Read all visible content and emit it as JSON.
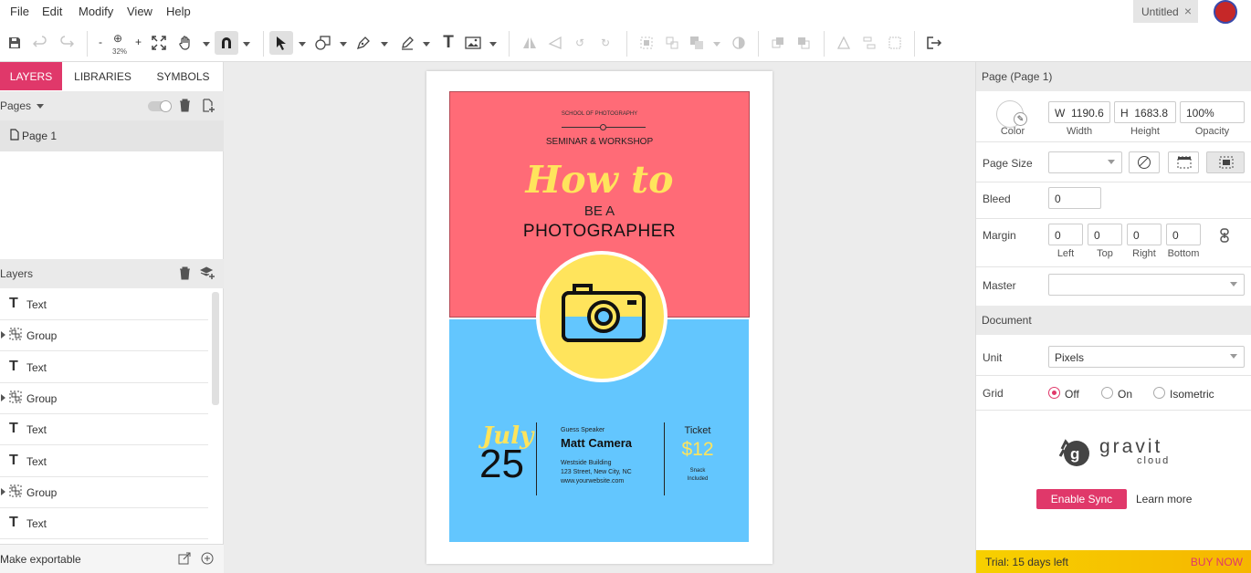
{
  "menu": {
    "file": "File",
    "edit": "Edit",
    "modify": "Modify",
    "view": "View",
    "help": "Help"
  },
  "doc_tab": {
    "title": "Untitled",
    "close": "×"
  },
  "toolbar": {
    "zoom_out": "-",
    "zoom_level": "32%",
    "zoom_in": "+"
  },
  "left": {
    "tabs": {
      "layers": "LAYERS",
      "libraries": "LIBRARIES",
      "symbols": "SYMBOLS"
    },
    "pages_label": "Pages",
    "page_item": "Page 1",
    "layers_label": "Layers",
    "layers": [
      {
        "type": "text",
        "label": "Text"
      },
      {
        "type": "group",
        "label": "Group"
      },
      {
        "type": "text",
        "label": "Text"
      },
      {
        "type": "group",
        "label": "Group"
      },
      {
        "type": "text",
        "label": "Text"
      },
      {
        "type": "text",
        "label": "Text"
      },
      {
        "type": "group",
        "label": "Group"
      },
      {
        "type": "text",
        "label": "Text"
      }
    ],
    "make_exportable": "Make exportable"
  },
  "poster": {
    "school": "SCHOOL OF PHOTOGRAPHY",
    "seminar": "SEMINAR & WORKSHOP",
    "how_to": "How to",
    "be_a": "BE A",
    "photographer": "PHOTOGRAPHER",
    "month": "July",
    "day": "25",
    "guest_label": "Guess Speaker",
    "speaker": "Matt Camera",
    "venue": "Westside Building",
    "street": "123 Street, New City, NC",
    "website": "www.yourwebsite.com",
    "ticket_label": "Ticket",
    "price": "$12",
    "snack": "Snack",
    "included": "Included",
    "colors": {
      "top": "#ff6b77",
      "bottom": "#63c6fe",
      "accent": "#ffe45c"
    }
  },
  "right": {
    "page_title": "Page (Page 1)",
    "color_label": "Color",
    "width_prefix": "W",
    "width_value": "1190.6",
    "width_label": "Width",
    "height_prefix": "H",
    "height_value": "1683.8",
    "height_label": "Height",
    "opacity_value": "100%",
    "opacity_label": "Opacity",
    "page_size_label": "Page Size",
    "bleed_label": "Bleed",
    "bleed_value": "0",
    "margin_label": "Margin",
    "margin_left": "0",
    "margin_top": "0",
    "margin_right": "0",
    "margin_bottom": "0",
    "margin_left_lbl": "Left",
    "margin_top_lbl": "Top",
    "margin_right_lbl": "Right",
    "margin_bottom_lbl": "Bottom",
    "master_label": "Master",
    "document_section": "Document",
    "unit_label": "Unit",
    "unit_value": "Pixels",
    "grid_label": "Grid",
    "grid_off": "Off",
    "grid_on": "On",
    "grid_iso": "Isometric",
    "brand_top": "gravit",
    "brand_bottom": "cloud",
    "enable_sync": "Enable Sync",
    "learn_more": "Learn more",
    "trial": "Trial: 15 days left",
    "buy_now": "BUY NOW"
  }
}
